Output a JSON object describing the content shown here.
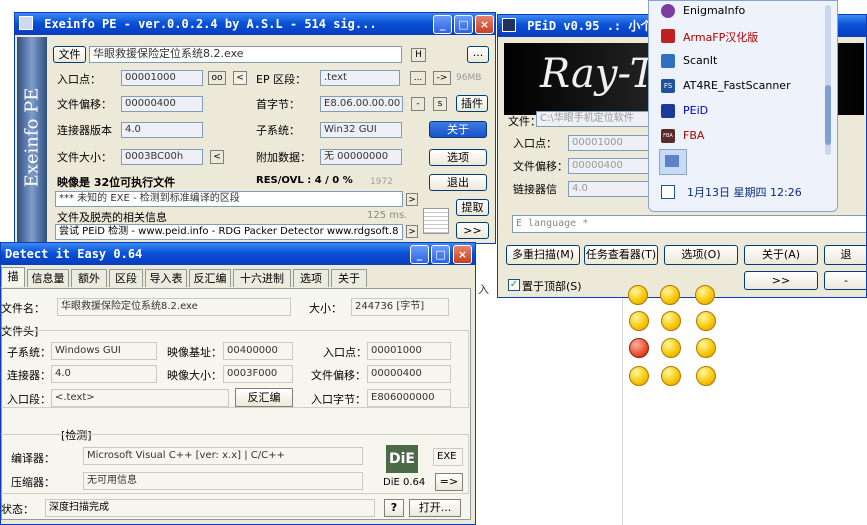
{
  "exeinfo": {
    "title": "Exeinfo PE - ver.0.0.2.4  by A.S.L -  514 sig...",
    "sidebar": "Exeinfo PE",
    "file_btn": "文件",
    "filename": "华眼救援保险定位系统8.2.exe",
    "h_btn": "H",
    "more_btn": "...",
    "entry_label": "入口点：",
    "entry": "00001000",
    "oo_btn": "oo",
    "lt_btn": "<",
    "ep_label": "EP 区段：",
    "ep": ".text",
    "dots_btn": "...",
    "gt_btn": "->",
    "size": "96MB",
    "offset_label": "文件偏移：",
    "offset": "00000400",
    "first_label": "首字节：",
    "first": "E8.06.00.00.00",
    "minus_btn": "-",
    "s_btn": "s",
    "plugin_btn": "插件",
    "linker_label": "连接器版本",
    "linker": "4.0",
    "subsys_label": "子系统：",
    "subsys": "Win32 GUI",
    "about_btn": "关于",
    "fsize_label": "文件大小：",
    "fsize": "0003BC00h",
    "fsize_btn": "<",
    "overlay_label": "附加数据：",
    "overlay": "无  00000000",
    "options_btn": "选项",
    "result": "映像是 32位可执行文件",
    "res_ovl": "RES/OVL : 4 / 0 %",
    "year": "1972",
    "exit_btn": "退出",
    "detect_line": "*** 未知的  EXE  - 检测到标准编译的区段",
    "detect_btn": ">",
    "extract_btn": "提取",
    "unpack_line": "文件及脱壳的相关信息",
    "time": "125 ms.",
    "try_line": "尝试 PEiD 检测 - www.peid.info - RDG Packer Detector www.rdgsoft.8",
    "next_btn": ">>"
  },
  "peid": {
    "title": "PEiD v0.95 .: 小个",
    "banner": "Ray-T",
    "file_label": "文件：",
    "file": "C:\\华眼手机定位软件",
    "entry_label": "入口点：",
    "entry": "00001000",
    "offset_label": "文件偏移：",
    "offset": "00000400",
    "linker_label": "链接器信",
    "linker": "4.0",
    "lang": "E language *",
    "multi_btn": "多重扫描(M)",
    "task_btn": "任务查看器(T)",
    "options_btn": "选项(O)",
    "about_btn": "关于(A)",
    "exit_btn": "退",
    "ontop": "置于顶部(S)",
    "next_btn": ">>",
    "dash_btn": "-",
    "peek": "入"
  },
  "menu": {
    "items": [
      {
        "label": "EnigmaInfo",
        "color": "#000000",
        "icon": "enigma-icon"
      },
      {
        "label": "ArmaFP汉化版",
        "color": "#b00000",
        "icon": "armafp-icon"
      },
      {
        "label": "ScanIt",
        "color": "#000000",
        "icon": "scanit-icon"
      },
      {
        "label": "AT4RE_FastScanner",
        "color": "#000000",
        "icon": "at4re-icon"
      },
      {
        "label": "PEiD",
        "color": "#0000c0",
        "icon": "peid-icon"
      },
      {
        "label": "FBA",
        "color": "#b00000",
        "icon": "fba-icon"
      }
    ],
    "fs_tag": "FS",
    "fba_tag": "FBA",
    "clock": "1月13日 星期四 12:26"
  },
  "die": {
    "title": "Detect it Easy 0.64",
    "tabs": [
      "描",
      "信息量",
      "额外",
      "区段",
      "导入表",
      "反汇编",
      "十六进制",
      "选项",
      "关于"
    ],
    "file_label": "文件名：",
    "file": "华眼救援保险定位系统8.2.exe",
    "size_label": "大小：",
    "size": "244736 [字节]",
    "header_group": "文件头]",
    "subsys_label": "子系统：",
    "subsys": "Windows GUI",
    "imagebase_label": "映像基址：",
    "imagebase": "00400000",
    "entry_label": "入口点：",
    "entry": "00001000",
    "linker_label": "连接器：",
    "linker": "4.0",
    "imagesize_label": "映像大小：",
    "imagesize": "0003F000",
    "offset_label": "文件偏移：",
    "offset": "00000400",
    "section_label": "入口段：",
    "section": "<.text>",
    "disasm_btn": "反汇编",
    "entrybytes_label": "入口字节：",
    "entrybytes": "E806000000",
    "detect_group": "[检测]",
    "compiler_label": "编译器：",
    "compiler": "Microsoft Visual C++ [ver: x.x] | C/C++",
    "packer_label": "压缩器：",
    "packer": "无可用信息",
    "logo": "DiE",
    "exe_tag": "EXE",
    "version": "DiE 0.64",
    "arrow_btn": "=>",
    "status_label": "状态：",
    "status": "深度扫描完成",
    "help_btn": "?",
    "open_btn": "打开..."
  }
}
